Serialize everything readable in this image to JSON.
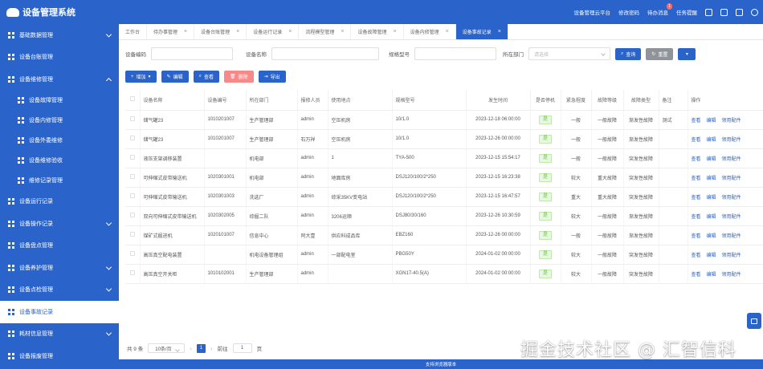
{
  "app": {
    "title": "设备管理系统",
    "accent": "#2a63c9"
  },
  "topbar": {
    "platform": "设备管理云平台",
    "change_password": "修改密码",
    "todo": "待办消息",
    "todo_badge": "1",
    "task_reminder": "任务提醒",
    "icons": [
      "shirt-icon",
      "fullscreen-icon",
      "lock-icon",
      "power-icon"
    ]
  },
  "sidebar": {
    "items": [
      {
        "label": "基础数据管理",
        "level": 1,
        "chevron": "down"
      },
      {
        "label": "设备台账管理",
        "level": 1
      },
      {
        "label": "设备维修管理",
        "level": 1,
        "chevron": "up"
      },
      {
        "label": "设备故障管理",
        "level": 2
      },
      {
        "label": "设备内修管理",
        "level": 2
      },
      {
        "label": "设备外委维修",
        "level": 2
      },
      {
        "label": "设备维修验收",
        "level": 2
      },
      {
        "label": "维修记录管理",
        "level": 2
      },
      {
        "label": "设备运行记录",
        "level": 1
      },
      {
        "label": "设备操作记录",
        "level": 1,
        "chevron": "down"
      },
      {
        "label": "设备盘点管理",
        "level": 1
      },
      {
        "label": "设备养护管理",
        "level": 1,
        "chevron": "down"
      },
      {
        "label": "设备点检管理",
        "level": 1,
        "chevron": "down"
      },
      {
        "label": "设备事故记录",
        "level": 1,
        "active": true
      },
      {
        "label": "耗材信息管理",
        "level": 1,
        "chevron": "down"
      },
      {
        "label": "设备报废管理",
        "level": 1
      }
    ]
  },
  "tabs": [
    {
      "label": "工作台",
      "closable": false
    },
    {
      "label": "待办事管理",
      "closable": true
    },
    {
      "label": "设备台账管理",
      "closable": true
    },
    {
      "label": "设备运行记录",
      "closable": true
    },
    {
      "label": "流程模型管理",
      "closable": true
    },
    {
      "label": "设备故障管理",
      "closable": true
    },
    {
      "label": "设备内修管理",
      "closable": true
    },
    {
      "label": "设备事故记录",
      "closable": true,
      "active": true
    }
  ],
  "search": {
    "code_label": "设备编码",
    "name_label": "设备名称",
    "spec_label": "规格型号",
    "dept_label": "所在部门",
    "dept_placeholder": "请选择",
    "query": "查询",
    "reset": "重置"
  },
  "toolbar": {
    "add": "增加",
    "edit": "编辑",
    "view": "查看",
    "delete": "删除",
    "export": "导出"
  },
  "table": {
    "headers": [
      "设备名称",
      "设备编号",
      "所在部门",
      "报修人员",
      "使用地点",
      "规格型号",
      "发生时间",
      "是否停机",
      "紧急程度",
      "故障等级",
      "故障类型",
      "备注",
      "操作"
    ],
    "actions": [
      "查看",
      "编辑",
      "领用配件"
    ],
    "rows": [
      [
        "储气罐23",
        "1010201007",
        "生产管理部",
        "admin",
        "空压机房",
        "10/1.0",
        "2023-12-18 06:00:00",
        "是",
        "一般",
        "一般故障",
        "渐发性故障",
        "测试"
      ],
      [
        "储气罐23",
        "1010201007",
        "生产管理部",
        "石万祥",
        "空压机房",
        "10/1.0",
        "2023-12-26 00:00:00",
        "是",
        "一般",
        "一般故障",
        "渐发性故障",
        ""
      ],
      [
        "液压支架调移装置",
        "",
        "机电部",
        "admin",
        "1",
        "TYA-500",
        "2023-12-15 15:54:17",
        "是",
        "一般",
        "一般故障",
        "突发性故障",
        ""
      ],
      [
        "可伸缩式皮带输送机",
        "1020301001",
        "机电部",
        "admin",
        "地面库房",
        "DSJ120/100/2*250",
        "2023-12-15 16:23:38",
        "是",
        "较大",
        "重大故障",
        "突发性故障",
        ""
      ],
      [
        "可伸缩式皮带输送机",
        "1020301003",
        "洗选厂",
        "admin",
        "综采35KV变电站",
        "DSJ120/100/2*250",
        "2023-12-15 16:47:57",
        "是",
        "重大",
        "重大故障",
        "突发性故障",
        ""
      ],
      [
        "双向可伸缩式皮带输送机",
        "1020302005",
        "综掘二队",
        "admin",
        "3206运顺",
        "DSJ80/30/160",
        "2023-12-26 10:30:59",
        "是",
        "较大",
        "一般故障",
        "渐发性故障",
        ""
      ],
      [
        "煤矿式掘进机",
        "1020101007",
        "信息中心",
        "阿大壹",
        "供应科成品库",
        "EBZ160",
        "2023-12-26 00:00:00",
        "是",
        "一般",
        "一般故障",
        "渐发性故障",
        ""
      ],
      [
        "高压真空配电装置",
        "",
        "机电设备管理组",
        "admin",
        "一部配电室",
        "PBG50Y",
        "2024-01-02 00:00:00",
        "是",
        "较大",
        "一般故障",
        "突发性故障",
        ""
      ],
      [
        "高压真空开关柜",
        "1010102001",
        "生产管理部",
        "admin",
        "",
        "XGN17-40.5(A)",
        "2024-01-02 00:00:00",
        "是",
        "较大",
        "一般故障",
        "突发性故障",
        ""
      ]
    ]
  },
  "pagination": {
    "total": "共 9 条",
    "page_size": "10条/页",
    "page": "1",
    "goto": "前往",
    "goto_value": "1",
    "page_unit": "页"
  },
  "footer": "支持浏览器版本",
  "watermark": "掘金技术社区 @ 汇智信科"
}
